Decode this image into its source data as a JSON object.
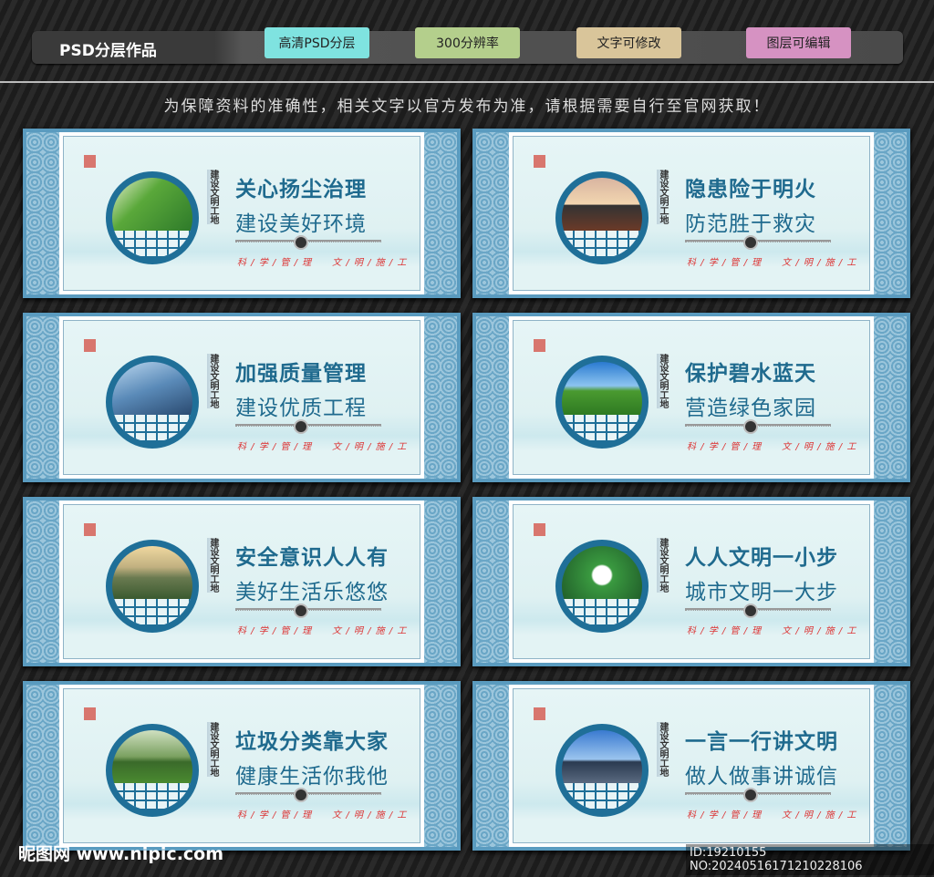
{
  "header": {
    "title": "PSD分层作品",
    "tags": [
      {
        "label": "高清PSD分层",
        "color": "#7fe3e0"
      },
      {
        "label": "300分辨率",
        "color": "#b4cf8c"
      },
      {
        "label": "文字可修改",
        "color": "#d9c59a"
      },
      {
        "label": "图层可编辑",
        "color": "#d692c2"
      }
    ]
  },
  "notice": "为保障资料的准确性，相关文字以官方发布为准，请根据需要自行至官网获取！",
  "panels": [
    {
      "line1": "关心扬尘治理",
      "line2": "建设美好环境",
      "photo": "linear-gradient(135deg,#e8f0d0,#5aa83a 40%,#2e7a2a)"
    },
    {
      "line1": "隐患险于明火",
      "line2": "防范胜于救灾",
      "photo": "linear-gradient(180deg,#d8b4a0,#f2d6b0 50%,#333 52%,#6b3a28)"
    },
    {
      "line1": "加强质量管理",
      "line2": "建设优质工程",
      "photo": "linear-gradient(160deg,#bcd8f0,#5a8ab8 50%,#2a4a70)"
    },
    {
      "line1": "保护碧水蓝天",
      "line2": "营造绿色家园",
      "photo": "linear-gradient(180deg,#2a7ad0,#8cc4f0 45%,#4a9a30 55%,#2e7a22)"
    },
    {
      "line1": "安全意识人人有",
      "line2": "美好生活乐悠悠",
      "photo": "linear-gradient(180deg,#f0d8a0,#c0b080 40%,#6a7a50 60%,#3a5a30)"
    },
    {
      "line1": "人人文明一小步",
      "line2": "城市文明一大步",
      "photo": "radial-gradient(circle at 50% 55%,#fff 0 10px,#3a9a40 12px,#1f5a28)"
    },
    {
      "line1": "垃圾分类靠大家",
      "line2": "健康生活你我他",
      "photo": "linear-gradient(180deg,#cfe0c0,#7aa060 50%,#3a6a2a 60%,#4a8a30)"
    },
    {
      "line1": "一言一行讲文明",
      "line2": "做人做事讲诚信",
      "photo": "linear-gradient(180deg,#3a7ad0,#9ac4ee 55%,#2a3a50 60%,#5a6a80)"
    }
  ],
  "vertical_text": "建设文明工地",
  "slogan": "科 / 学 / 管 / 理　　文 / 明 / 施 / 工",
  "watermark": {
    "logo": "昵图网 www.nipic.com",
    "id": "ID:19210155 NO:20240516171210228106"
  }
}
